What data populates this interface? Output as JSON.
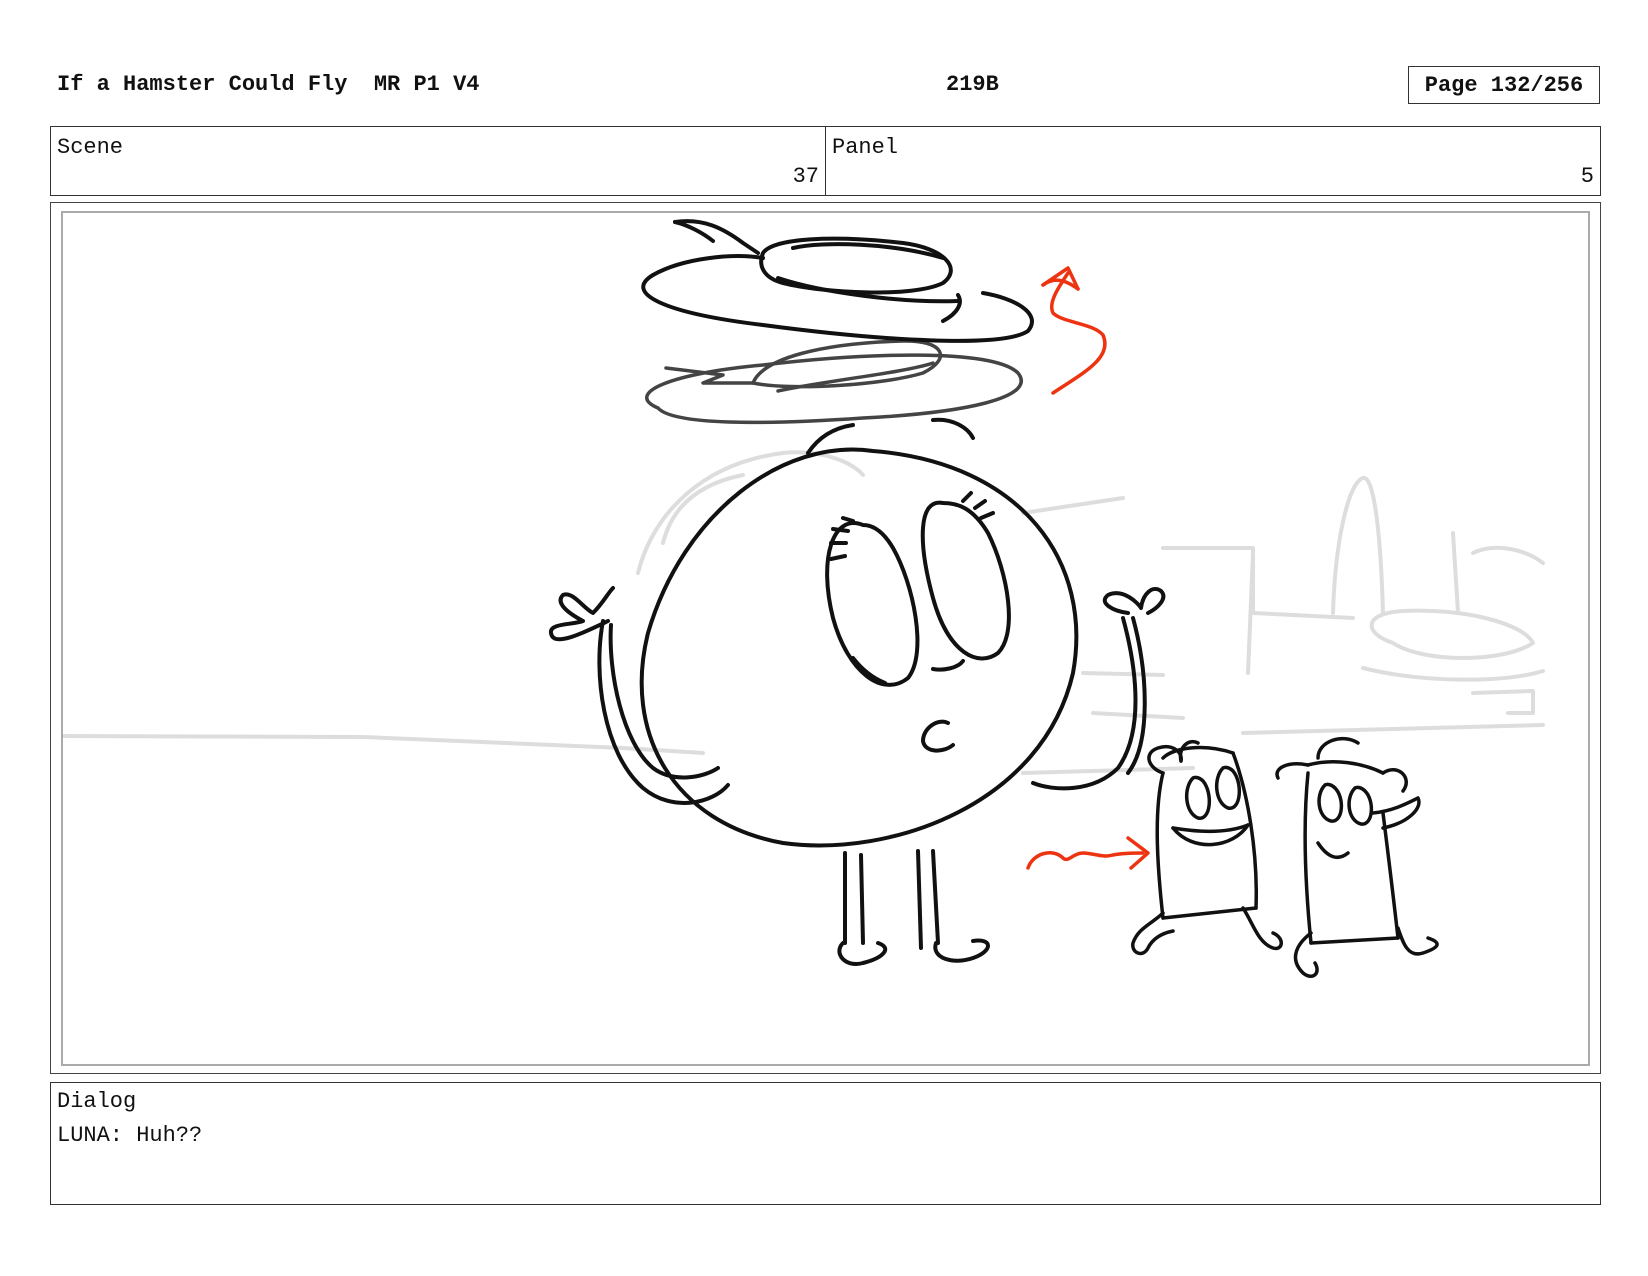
{
  "header": {
    "title": "If a Hamster Could Fly  MR P1 V4",
    "code": "219B",
    "page": "Page 132/256"
  },
  "info": {
    "scene_label": "Scene",
    "scene_value": "37",
    "panel_label": "Panel",
    "panel_value": "5"
  },
  "dialog": {
    "label": "Dialog",
    "text": "LUNA: Huh??"
  },
  "colors": {
    "ink": "#111111",
    "background_sketch": "#dddddd",
    "arrow": "#ee3311"
  },
  "drawing": {
    "description_icon": "storyboard-sketch"
  }
}
